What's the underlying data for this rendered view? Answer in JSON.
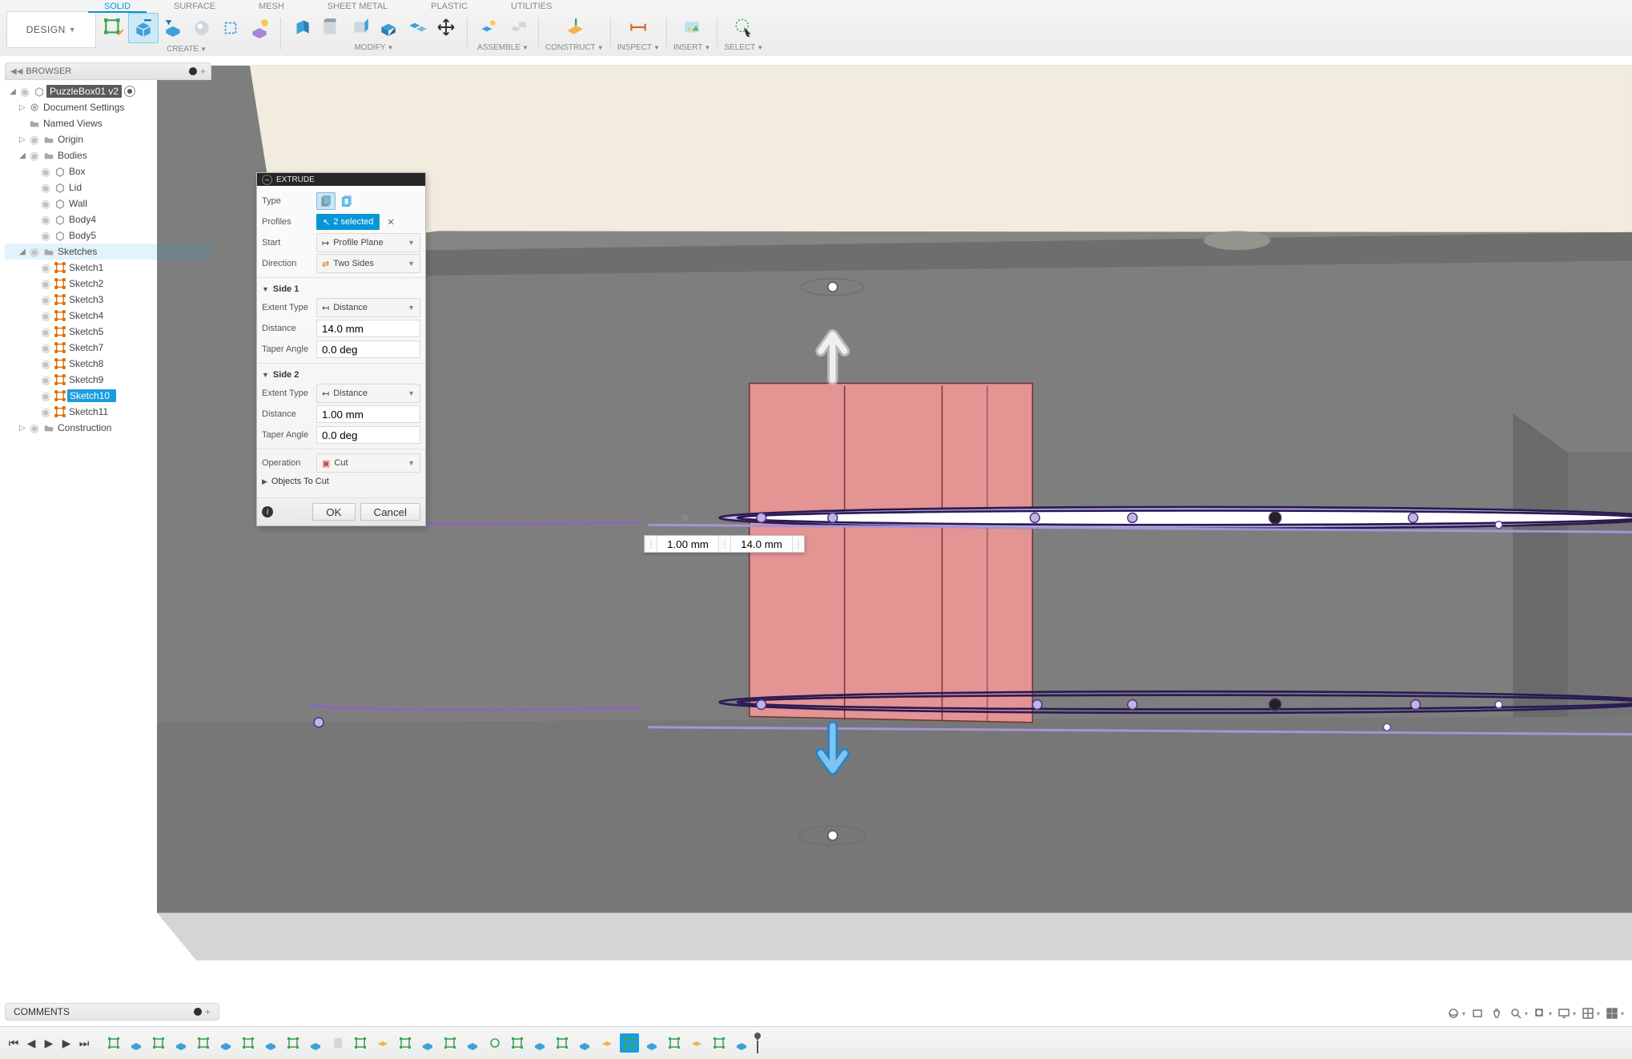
{
  "design_label": "DESIGN",
  "ribbon_tabs": [
    "SOLID",
    "SURFACE",
    "MESH",
    "SHEET METAL",
    "PLASTIC",
    "UTILITIES"
  ],
  "ribbon_groups": {
    "create": "CREATE",
    "modify": "MODIFY",
    "assemble": "ASSEMBLE",
    "construct": "CONSTRUCT",
    "inspect": "INSPECT",
    "insert": "INSERT",
    "select": "SELECT"
  },
  "browser": {
    "title": "BROWSER",
    "root": "PuzzleBox01 v2",
    "doc_settings": "Document Settings",
    "named_views": "Named Views",
    "origin": "Origin",
    "bodies": "Bodies",
    "body_items": [
      "Box",
      "Lid",
      "Wall",
      "Body4",
      "Body5"
    ],
    "sketches": "Sketches",
    "sketch_items": [
      "Sketch1",
      "Sketch2",
      "Sketch3",
      "Sketch4",
      "Sketch5",
      "Sketch7",
      "Sketch8",
      "Sketch9",
      "Sketch10",
      "Sketch11"
    ],
    "sketch_selected": "Sketch10",
    "construction": "Construction"
  },
  "extrude": {
    "title": "EXTRUDE",
    "labels": {
      "type": "Type",
      "profiles": "Profiles",
      "start": "Start",
      "direction": "Direction",
      "side1": "Side 1",
      "side2": "Side 2",
      "extent": "Extent Type",
      "distance": "Distance",
      "taper": "Taper Angle",
      "operation": "Operation",
      "objects": "Objects To Cut"
    },
    "profiles_value": "2 selected",
    "start_value": "Profile Plane",
    "direction_value": "Two Sides",
    "extent_value": "Distance",
    "side1_distance": "14.0 mm",
    "side1_taper": "0.0 deg",
    "side2_distance": "1.00 mm",
    "side2_taper": "0.0 deg",
    "operation_value": "Cut",
    "ok": "OK",
    "cancel": "Cancel"
  },
  "dim_input_1": "1.00 mm",
  "dim_input_2": "14.0 mm",
  "comments_title": "COMMENTS"
}
